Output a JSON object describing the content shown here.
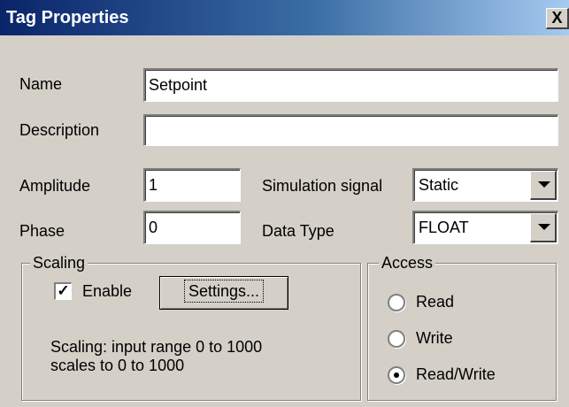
{
  "window": {
    "title": "Tag Properties",
    "close_glyph": "X"
  },
  "form": {
    "name_label": "Name",
    "name_value": "Setpoint",
    "description_label": "Description",
    "description_value": "",
    "amplitude_label": "Amplitude",
    "amplitude_value": "1",
    "phase_label": "Phase",
    "phase_value": "0",
    "simulation_label": "Simulation signal",
    "simulation_value": "Static",
    "datatype_label": "Data Type",
    "datatype_value": "FLOAT"
  },
  "scaling": {
    "title": "Scaling",
    "enable_label": "Enable",
    "enable_checked": true,
    "check_glyph": "✓",
    "settings_label": "Settings...",
    "info_line1": "Scaling: input range 0 to 1000",
    "info_line2": "scales to 0 to 1000"
  },
  "access": {
    "title": "Access",
    "options": [
      {
        "label": "Read",
        "selected": false
      },
      {
        "label": "Write",
        "selected": false
      },
      {
        "label": "Read/Write",
        "selected": true
      }
    ]
  }
}
